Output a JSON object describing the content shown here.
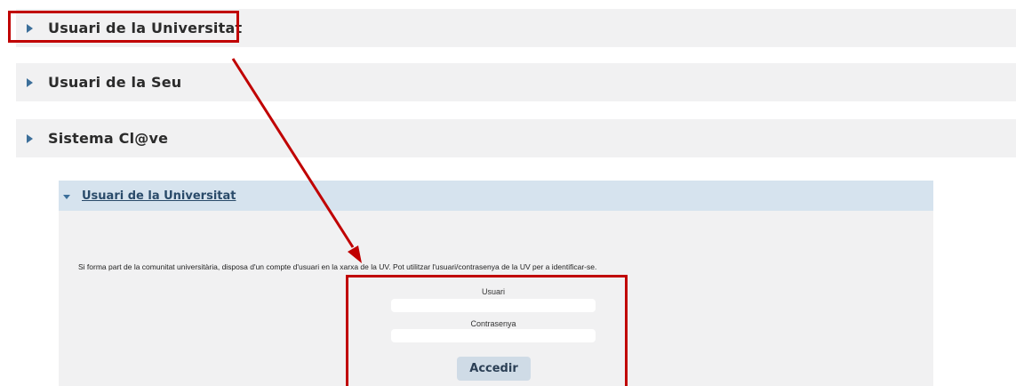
{
  "accordion": [
    {
      "label": "Usuari de la Universitat"
    },
    {
      "label": "Usuari de la Seu"
    },
    {
      "label": "Sistema Cl@ve"
    }
  ],
  "panel": {
    "title": "Usuari de la Universitat",
    "info": "Si forma part de la comunitat universitària, disposa d'un compte d'usuari en la xarxa de la UV. Pot utilitzar l'usuari/contrasenya de la UV per a identificar-se.",
    "user_label": "Usuari",
    "user_value": "",
    "password_label": "Contrasenya",
    "password_value": "",
    "submit_label": "Accedir"
  },
  "annotation": {
    "color": "#c00000"
  }
}
